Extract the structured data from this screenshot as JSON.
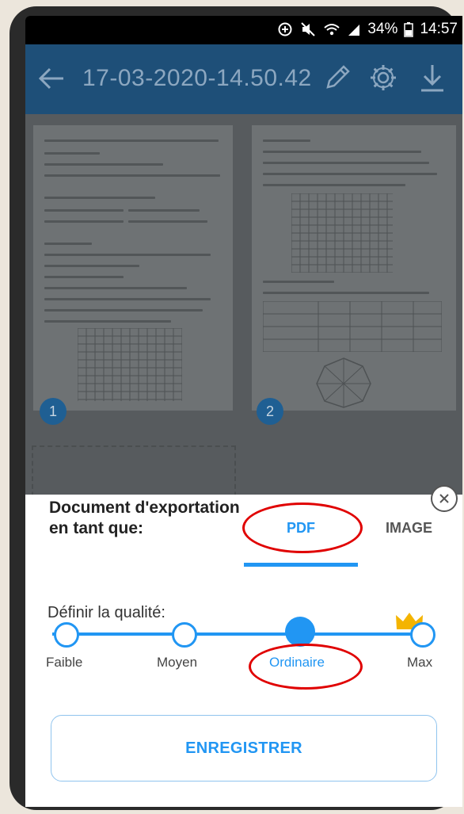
{
  "status_bar": {
    "battery": "34%",
    "time": "14:57"
  },
  "app_bar": {
    "title": "17-03-2020-14.50.42",
    "back_icon": "back-arrow-icon",
    "actions": [
      "pencil-icon",
      "gear-icon",
      "download-icon"
    ]
  },
  "document": {
    "pages": [
      {
        "number": "1"
      },
      {
        "number": "2"
      }
    ]
  },
  "export_sheet": {
    "label": "Document d'exportation en tant que:",
    "tabs": [
      {
        "label": "PDF",
        "selected": true
      },
      {
        "label": "IMAGE",
        "selected": false
      }
    ],
    "quality_label": "Définir la qualité:",
    "quality_levels": [
      "Faible",
      "Moyen",
      "Ordinaire",
      "Max"
    ],
    "selected_quality": "Ordinaire",
    "premium_icon": "crown-icon",
    "save_label": "ENREGISTRER"
  },
  "colors": {
    "accent": "#2196f3",
    "appbar": "#1e4f78",
    "annotation_ring": "#e00000",
    "crown": "#f4b400"
  }
}
